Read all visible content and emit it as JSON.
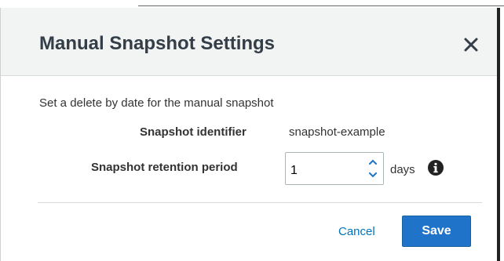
{
  "dialog": {
    "title": "Manual Snapshot Settings",
    "close_icon": "close-icon",
    "intro": "Set a delete by date for the manual snapshot",
    "identifier": {
      "label": "Snapshot identifier",
      "value": "snapshot-example"
    },
    "retention": {
      "label": "Snapshot retention period",
      "value": "1",
      "unit": "days",
      "info_icon": "info-icon"
    },
    "actions": {
      "cancel_label": "Cancel",
      "save_label": "Save"
    }
  },
  "colors": {
    "header_bg": "#f2f3f3",
    "title_text": "#333e48",
    "link": "#0073bb",
    "primary_button": "#1f73c9"
  }
}
